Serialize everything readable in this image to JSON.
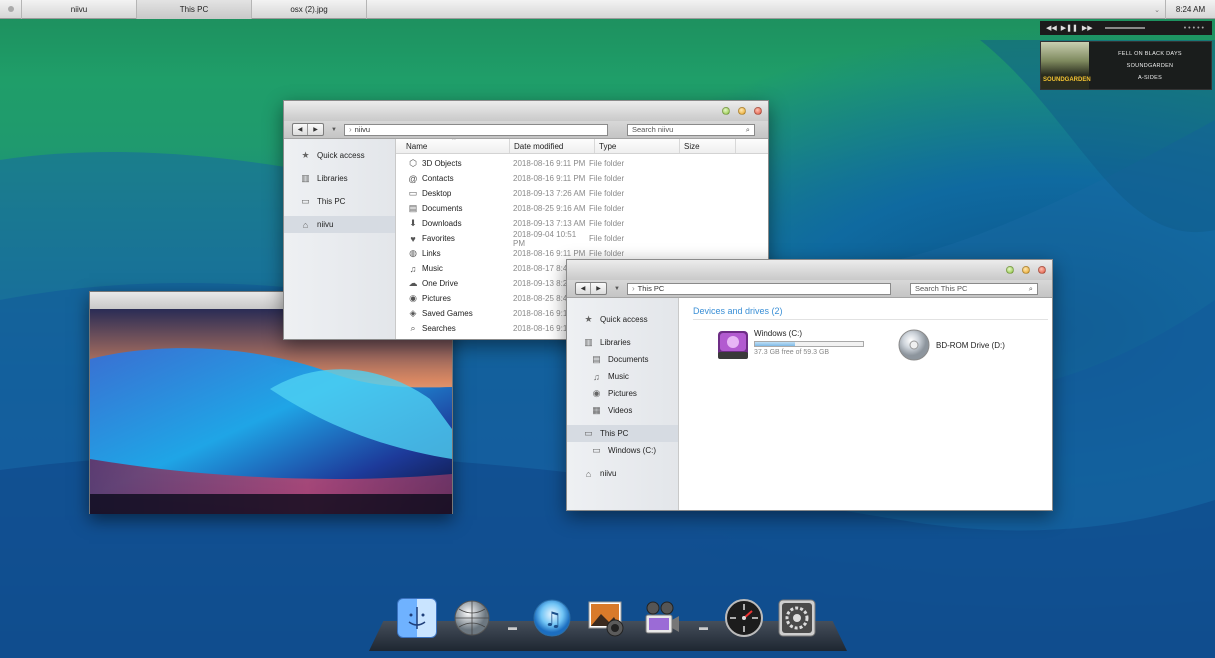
{
  "taskbar": {
    "items": [
      {
        "label": "niivu",
        "active": false
      },
      {
        "label": "This PC",
        "active": true
      },
      {
        "label": "osx (2).jpg",
        "active": false
      }
    ],
    "tray_icon": "chevron-down",
    "clock": "8:24 AM"
  },
  "media": {
    "controls": [
      "previous",
      "play-pause",
      "next"
    ],
    "track": "FELL ON BLACK DAYS",
    "artist": "SOUNDGARDEN",
    "album": "A-SIDES",
    "album_art_text": "SOUNDGARDEN"
  },
  "win1": {
    "address": "niivu",
    "search_placeholder": "Search niivu",
    "nav": [
      {
        "label": "Quick access",
        "icon": "star-icon"
      },
      {
        "label": "Libraries",
        "icon": "libraries-icon"
      },
      {
        "label": "This PC",
        "icon": "computer-icon"
      },
      {
        "label": "niivu",
        "icon": "user-icon",
        "selected": true
      }
    ],
    "columns": [
      "Name",
      "Date modified",
      "Type",
      "Size"
    ],
    "rows": [
      {
        "name": "3D Objects",
        "date": "2018-08-16 9:11 PM",
        "type": "File folder",
        "icon": "cube-icon"
      },
      {
        "name": "Contacts",
        "date": "2018-08-16 9:11 PM",
        "type": "File folder",
        "icon": "at-icon"
      },
      {
        "name": "Desktop",
        "date": "2018-09-13 7:26 AM",
        "type": "File folder",
        "icon": "desktop-icon"
      },
      {
        "name": "Documents",
        "date": "2018-08-25 9:16 AM",
        "type": "File folder",
        "icon": "document-icon"
      },
      {
        "name": "Downloads",
        "date": "2018-09-13 7:13 AM",
        "type": "File folder",
        "icon": "download-icon"
      },
      {
        "name": "Favorites",
        "date": "2018-09-04 10:51 PM",
        "type": "File folder",
        "icon": "heart-icon"
      },
      {
        "name": "Links",
        "date": "2018-08-16 9:11 PM",
        "type": "File folder",
        "icon": "globe-icon"
      },
      {
        "name": "Music",
        "date": "2018-08-17 8:4",
        "type": "",
        "icon": "music-icon"
      },
      {
        "name": "One Drive",
        "date": "2018-09-13 8:2",
        "type": "",
        "icon": "cloud-icon"
      },
      {
        "name": "Pictures",
        "date": "2018-08-25 8:4",
        "type": "",
        "icon": "camera-icon"
      },
      {
        "name": "Saved Games",
        "date": "2018-08-16 9:1",
        "type": "",
        "icon": "gamepad-icon"
      },
      {
        "name": "Searches",
        "date": "2018-08-16 9:1",
        "type": "",
        "icon": "search-icon"
      }
    ]
  },
  "win2": {
    "address": "This PC",
    "search_placeholder": "Search This PC",
    "nav": [
      {
        "label": "Quick access",
        "icon": "star-icon",
        "sub": false
      },
      {
        "label": "Libraries",
        "icon": "libraries-icon",
        "sub": false
      },
      {
        "label": "Documents",
        "icon": "document-icon",
        "sub": true
      },
      {
        "label": "Music",
        "icon": "music-icon",
        "sub": true
      },
      {
        "label": "Pictures",
        "icon": "camera-icon",
        "sub": true
      },
      {
        "label": "Videos",
        "icon": "film-icon",
        "sub": true
      },
      {
        "label": "This PC",
        "icon": "computer-icon",
        "sub": false,
        "selected": true
      },
      {
        "label": "Windows (C:)",
        "icon": "drive-icon",
        "sub": true
      },
      {
        "label": "niivu",
        "icon": "user-icon",
        "sub": false
      }
    ],
    "section_title": "Devices and drives (2)",
    "drives": [
      {
        "name": "Windows (C:)",
        "free": "37.3 GB free of 59.3 GB",
        "used_fraction": 0.37,
        "icon": "hard-drive-icon"
      },
      {
        "name": "BD-ROM Drive (D:)",
        "icon": "disc-icon"
      }
    ]
  },
  "photo_viewer": {
    "title": "osx (2).jpg"
  },
  "dock": {
    "apps": [
      "finder-icon",
      "network-globe-icon",
      "itunes-icon",
      "photos-icon",
      "video-editor-icon",
      "dashboard-icon",
      "system-preferences-icon"
    ]
  },
  "colors": {
    "accent": "#3a8fd6",
    "selection": "#d6dbe2"
  }
}
